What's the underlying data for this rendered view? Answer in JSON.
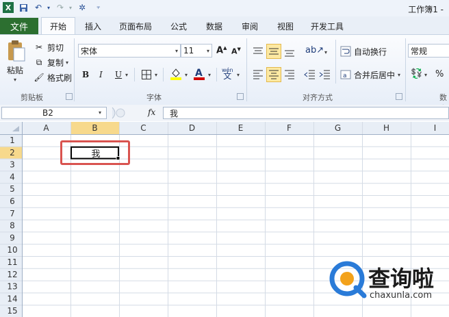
{
  "quick_access": {
    "icons": [
      "excel-logo-icon",
      "save-icon",
      "undo-icon",
      "redo-icon",
      "magic-wand-icon",
      "customize-icon"
    ]
  },
  "window": {
    "title": "工作簿1 -"
  },
  "tabs": {
    "file": "文件",
    "items": [
      "开始",
      "插入",
      "页面布局",
      "公式",
      "数据",
      "审阅",
      "视图",
      "开发工具"
    ]
  },
  "clipboard": {
    "paste": "粘贴",
    "cut": "剪切",
    "copy": "复制",
    "format_painter": "格式刷",
    "group": "剪贴板"
  },
  "font": {
    "name": "宋体",
    "size": "11",
    "bold": "B",
    "italic": "I",
    "underline": "U",
    "group": "字体",
    "phonetic": "wén"
  },
  "alignment": {
    "wrap": "自动换行",
    "merge": "合并后居中",
    "group": "对齐方式"
  },
  "number": {
    "format": "常规",
    "percent": "%",
    "group": "数字"
  },
  "formula_bar": {
    "name_box": "B2",
    "fx": "fx",
    "value": "我"
  },
  "grid": {
    "columns": [
      "A",
      "B",
      "C",
      "D",
      "E",
      "F",
      "G",
      "H",
      "I"
    ],
    "rows": [
      "1",
      "2",
      "3",
      "4",
      "5",
      "6",
      "7",
      "8",
      "9",
      "10",
      "11",
      "12",
      "13",
      "14",
      "15"
    ],
    "selected_cell": "B2",
    "cell_b2": "我"
  },
  "watermark": {
    "text": "查询啦",
    "url": "chaxunla.com"
  },
  "colors": {
    "file_tab": "#2c6f30",
    "highlight": "#fde9a2",
    "selected_header": "#f7d98c",
    "annotation": "#d9534f"
  }
}
